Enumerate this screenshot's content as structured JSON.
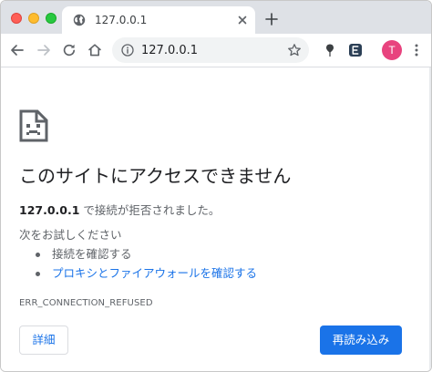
{
  "window": {
    "controls": {
      "close_color": "#fe5f57",
      "minimize_color": "#febc2e",
      "maximize_color": "#28c840"
    }
  },
  "tab": {
    "title": "127.0.0.1",
    "favicon": "globe-icon",
    "close_icon": "close-icon"
  },
  "new_tab_icon": "plus-icon",
  "toolbar": {
    "back_icon": "arrow-left-icon",
    "forward_icon": "arrow-right-icon",
    "reload_icon": "reload-icon",
    "home_icon": "home-icon",
    "site_info_icon": "info-icon",
    "url": "127.0.0.1",
    "bookmark_icon": "star-icon",
    "extension_1_icon": "pin-icon",
    "extension_2_icon": "extension-badge-icon",
    "profile_initial": "T",
    "profile_color": "#e8437e",
    "menu_icon": "kebab-menu-icon"
  },
  "error_page": {
    "icon": "broken-page-icon",
    "heading": "このサイトにアクセスできません",
    "host": "127.0.0.1",
    "summary_rest": " で接続が拒否されました。",
    "try_label": "次をお試しください",
    "suggestions": [
      "接続を確認する",
      "プロキシとファイアウォールを確認する"
    ],
    "error_code": "ERR_CONNECTION_REFUSED",
    "details_button": "詳細",
    "reload_button": "再読み込み",
    "accent_color": "#1a73e8"
  }
}
